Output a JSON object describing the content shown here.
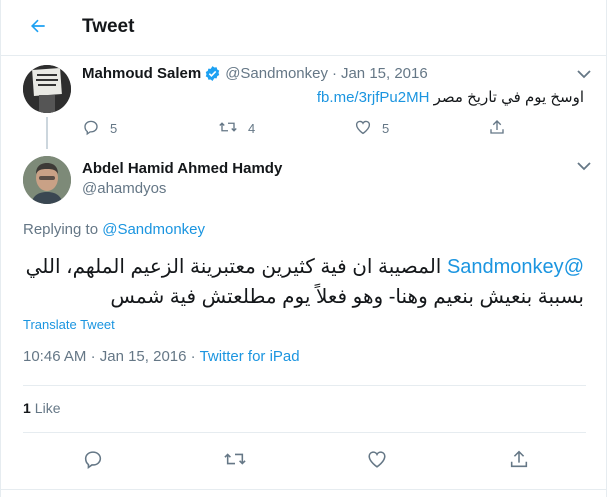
{
  "header": {
    "title": "Tweet"
  },
  "parent_tweet": {
    "author_name": "Mahmoud Salem",
    "handle": "@Sandmonkey",
    "separator": "·",
    "date": "Jan 15, 2016",
    "text": "اوسخ يوم في تاريخ مصر",
    "link": "fb.me/3rjfPu2MH",
    "replies": "5",
    "retweets": "4",
    "likes": "5"
  },
  "main_tweet": {
    "author_name": "Abdel Hamid Ahmed Hamdy",
    "handle": "@ahamdyos",
    "replying_prefix": "Replying to",
    "replying_to": "@Sandmonkey",
    "mention": "@Sandmonkey",
    "text_line1": "المصيبة ان فية كثيرين معتبرينة الزعيم الملهم، اللي",
    "text_line2": "بسببة بنعيش بنعيم وهنا- وهو فعلاً يوم مطلعتش فية شمس",
    "translate_label": "Translate Tweet",
    "time": "10:46 AM",
    "separator": "·",
    "date": "Jan 15, 2016",
    "source": "Twitter for iPad",
    "like_count": "1",
    "like_label": "Like"
  },
  "colors": {
    "accent": "#1da1f2",
    "link": "#1b95e0",
    "muted": "#657786",
    "border": "#e6ecf0"
  },
  "icons": [
    "back-arrow-icon",
    "verified-badge-icon",
    "chevron-down-icon",
    "reply-icon",
    "retweet-icon",
    "like-icon",
    "share-icon"
  ]
}
